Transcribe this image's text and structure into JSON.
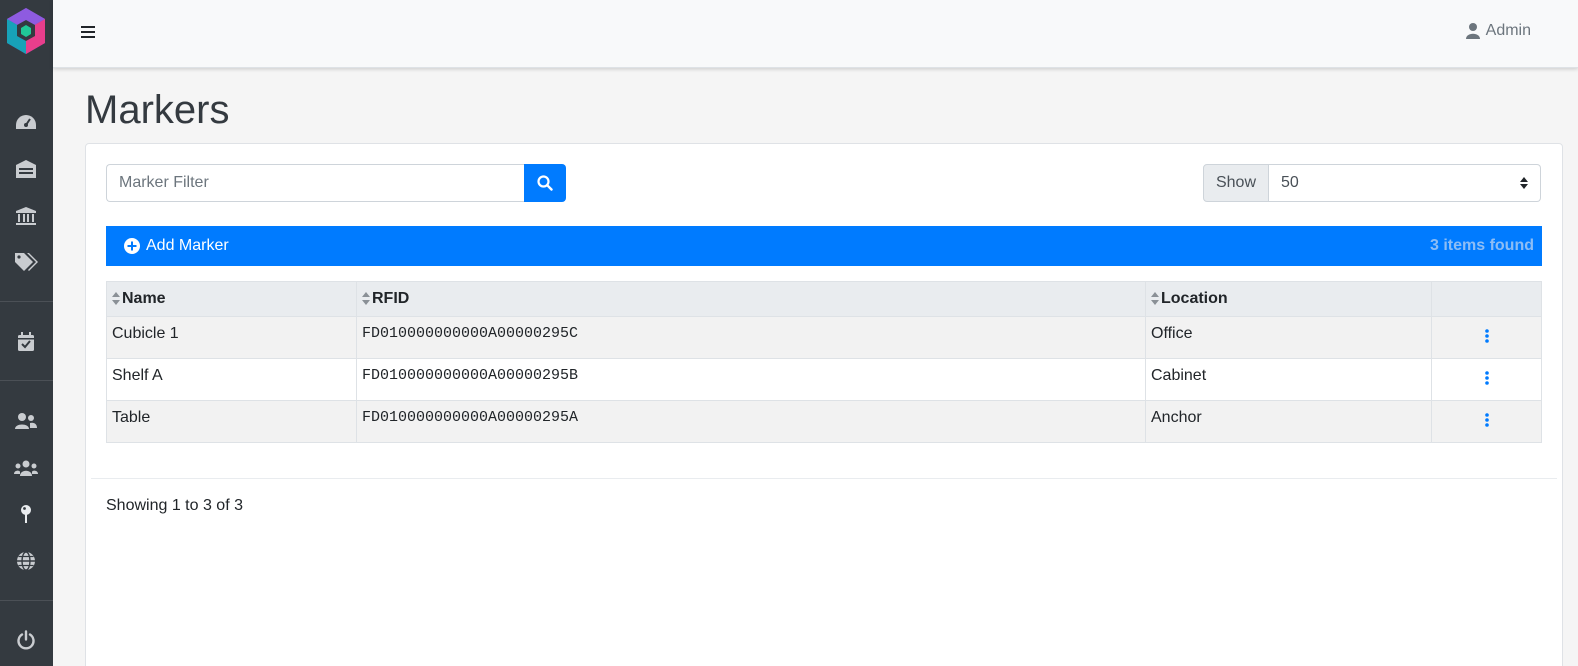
{
  "header": {
    "user_label": "Admin"
  },
  "page": {
    "title": "Markers"
  },
  "filter": {
    "placeholder": "Marker Filter"
  },
  "page_size": {
    "label": "Show",
    "value": "50"
  },
  "toolbar": {
    "add_label": "Add Marker",
    "found_text": "3 items found"
  },
  "table": {
    "columns": [
      "Name",
      "RFID",
      "Location"
    ],
    "rows": [
      {
        "name": "Cubicle 1",
        "rfid": "FD010000000000A00000295C",
        "location": "Office"
      },
      {
        "name": "Shelf A",
        "rfid": "FD010000000000A00000295B",
        "location": "Cabinet"
      },
      {
        "name": "Table",
        "rfid": "FD010000000000A00000295A",
        "location": "Anchor"
      }
    ]
  },
  "footer": {
    "showing_text": "Showing 1 to 3 of 3"
  },
  "sidebar": {
    "icons": [
      "dashboard-icon",
      "warehouse-icon",
      "institution-icon",
      "tags-icon",
      "calendar-check-icon",
      "users-icon",
      "groups-icon",
      "map-pin-icon",
      "globe-icon",
      "power-icon"
    ]
  },
  "colors": {
    "accent": "#007bff",
    "sidebar": "#343a40"
  }
}
